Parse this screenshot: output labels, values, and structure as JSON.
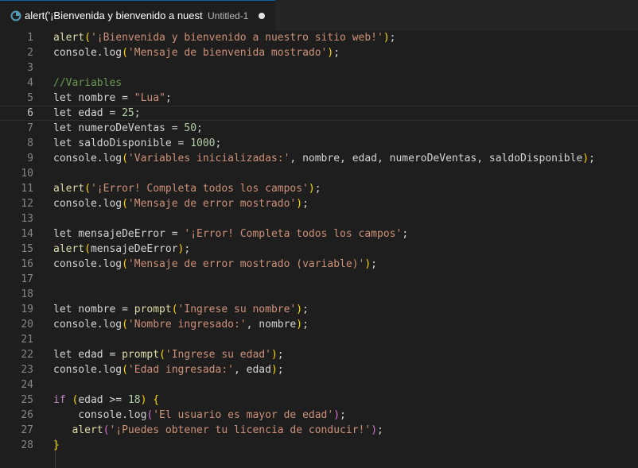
{
  "tab": {
    "title": "alert('¡Bienvenida y bienvenido a nuestr",
    "description": "Untitled-1",
    "icon": "javascript-file-icon"
  },
  "editor": {
    "current_line": 6,
    "lines": [
      {
        "n": "1",
        "tokens": [
          {
            "t": "fn",
            "v": "alert"
          },
          {
            "t": "p1",
            "v": "("
          },
          {
            "t": "str",
            "v": "'¡Bienvenida y bienvenido a nuestro sitio web!'"
          },
          {
            "t": "p1",
            "v": ")"
          },
          {
            "t": "plain",
            "v": ";"
          }
        ]
      },
      {
        "n": "2",
        "tokens": [
          {
            "t": "plain",
            "v": "console.log"
          },
          {
            "t": "p1",
            "v": "("
          },
          {
            "t": "str",
            "v": "'Mensaje de bienvenida mostrado'"
          },
          {
            "t": "p1",
            "v": ")"
          },
          {
            "t": "plain",
            "v": ";"
          }
        ]
      },
      {
        "n": "3",
        "tokens": []
      },
      {
        "n": "4",
        "tokens": [
          {
            "t": "com",
            "v": "//Variables"
          }
        ]
      },
      {
        "n": "5",
        "tokens": [
          {
            "t": "plain",
            "v": "let nombre = "
          },
          {
            "t": "str",
            "v": "\"Lua\""
          },
          {
            "t": "plain",
            "v": ";"
          }
        ]
      },
      {
        "n": "6",
        "tokens": [
          {
            "t": "plain",
            "v": "let edad = "
          },
          {
            "t": "num",
            "v": "25"
          },
          {
            "t": "plain",
            "v": ";"
          }
        ]
      },
      {
        "n": "7",
        "tokens": [
          {
            "t": "plain",
            "v": "let numeroDeVentas = "
          },
          {
            "t": "num",
            "v": "50"
          },
          {
            "t": "plain",
            "v": ";"
          }
        ]
      },
      {
        "n": "8",
        "tokens": [
          {
            "t": "plain",
            "v": "let saldoDisponible = "
          },
          {
            "t": "num",
            "v": "1000"
          },
          {
            "t": "plain",
            "v": ";"
          }
        ]
      },
      {
        "n": "9",
        "tokens": [
          {
            "t": "plain",
            "v": "console.log"
          },
          {
            "t": "p1",
            "v": "("
          },
          {
            "t": "str",
            "v": "'Variables inicializadas:'"
          },
          {
            "t": "plain",
            "v": ", nombre, edad, numeroDeVentas, saldoDisponible"
          },
          {
            "t": "p1",
            "v": ")"
          },
          {
            "t": "plain",
            "v": ";"
          }
        ]
      },
      {
        "n": "10",
        "tokens": []
      },
      {
        "n": "11",
        "tokens": [
          {
            "t": "fn",
            "v": "alert"
          },
          {
            "t": "p1",
            "v": "("
          },
          {
            "t": "str",
            "v": "'¡Error! Completa todos los campos'"
          },
          {
            "t": "p1",
            "v": ")"
          },
          {
            "t": "plain",
            "v": ";"
          }
        ]
      },
      {
        "n": "12",
        "tokens": [
          {
            "t": "plain",
            "v": "console.log"
          },
          {
            "t": "p1",
            "v": "("
          },
          {
            "t": "str",
            "v": "'Mensaje de error mostrado'"
          },
          {
            "t": "p1",
            "v": ")"
          },
          {
            "t": "plain",
            "v": ";"
          }
        ]
      },
      {
        "n": "13",
        "tokens": []
      },
      {
        "n": "14",
        "tokens": [
          {
            "t": "plain",
            "v": "let mensajeDeError = "
          },
          {
            "t": "str",
            "v": "'¡Error! Completa todos los campos'"
          },
          {
            "t": "plain",
            "v": ";"
          }
        ]
      },
      {
        "n": "15",
        "tokens": [
          {
            "t": "fn",
            "v": "alert"
          },
          {
            "t": "p1",
            "v": "("
          },
          {
            "t": "plain",
            "v": "mensajeDeError"
          },
          {
            "t": "p1",
            "v": ")"
          },
          {
            "t": "plain",
            "v": ";"
          }
        ]
      },
      {
        "n": "16",
        "tokens": [
          {
            "t": "plain",
            "v": "console.log"
          },
          {
            "t": "p1",
            "v": "("
          },
          {
            "t": "str",
            "v": "'Mensaje de error mostrado (variable)'"
          },
          {
            "t": "p1",
            "v": ")"
          },
          {
            "t": "plain",
            "v": ";"
          }
        ]
      },
      {
        "n": "17",
        "tokens": []
      },
      {
        "n": "18",
        "tokens": []
      },
      {
        "n": "19",
        "tokens": [
          {
            "t": "plain",
            "v": "let nombre = "
          },
          {
            "t": "fn",
            "v": "prompt"
          },
          {
            "t": "p1",
            "v": "("
          },
          {
            "t": "str",
            "v": "'Ingrese su nombre'"
          },
          {
            "t": "p1",
            "v": ")"
          },
          {
            "t": "plain",
            "v": ";"
          }
        ]
      },
      {
        "n": "20",
        "tokens": [
          {
            "t": "plain",
            "v": "console.log"
          },
          {
            "t": "p1",
            "v": "("
          },
          {
            "t": "str",
            "v": "'Nombre ingresado:'"
          },
          {
            "t": "plain",
            "v": ", nombre"
          },
          {
            "t": "p1",
            "v": ")"
          },
          {
            "t": "plain",
            "v": ";"
          }
        ]
      },
      {
        "n": "21",
        "tokens": []
      },
      {
        "n": "22",
        "tokens": [
          {
            "t": "plain",
            "v": "let edad = "
          },
          {
            "t": "fn",
            "v": "prompt"
          },
          {
            "t": "p1",
            "v": "("
          },
          {
            "t": "str",
            "v": "'Ingrese su edad'"
          },
          {
            "t": "p1",
            "v": ")"
          },
          {
            "t": "plain",
            "v": ";"
          }
        ]
      },
      {
        "n": "23",
        "tokens": [
          {
            "t": "plain",
            "v": "console.log"
          },
          {
            "t": "p1",
            "v": "("
          },
          {
            "t": "str",
            "v": "'Edad ingresada:'"
          },
          {
            "t": "plain",
            "v": ", edad"
          },
          {
            "t": "p1",
            "v": ")"
          },
          {
            "t": "plain",
            "v": ";"
          }
        ]
      },
      {
        "n": "24",
        "tokens": []
      },
      {
        "n": "25",
        "tokens": [
          {
            "t": "kw",
            "v": "if"
          },
          {
            "t": "plain",
            "v": " "
          },
          {
            "t": "p1",
            "v": "("
          },
          {
            "t": "plain",
            "v": "edad >= "
          },
          {
            "t": "num",
            "v": "18"
          },
          {
            "t": "p1",
            "v": ")"
          },
          {
            "t": "plain",
            "v": " "
          },
          {
            "t": "p1",
            "v": "{"
          }
        ]
      },
      {
        "n": "26",
        "tokens": [
          {
            "t": "plain",
            "v": "    console.log"
          },
          {
            "t": "p2",
            "v": "("
          },
          {
            "t": "str",
            "v": "'El usuario es mayor de edad'"
          },
          {
            "t": "p2",
            "v": ")"
          },
          {
            "t": "plain",
            "v": ";"
          }
        ]
      },
      {
        "n": "27",
        "tokens": [
          {
            "t": "plain",
            "v": "   "
          },
          {
            "t": "fn",
            "v": "alert"
          },
          {
            "t": "p2",
            "v": "("
          },
          {
            "t": "str",
            "v": "'¡Puedes obtener tu licencia de conducir!'"
          },
          {
            "t": "p2",
            "v": ")"
          },
          {
            "t": "plain",
            "v": ";"
          }
        ]
      },
      {
        "n": "28",
        "tokens": [
          {
            "t": "p1",
            "v": "}"
          }
        ]
      }
    ]
  }
}
